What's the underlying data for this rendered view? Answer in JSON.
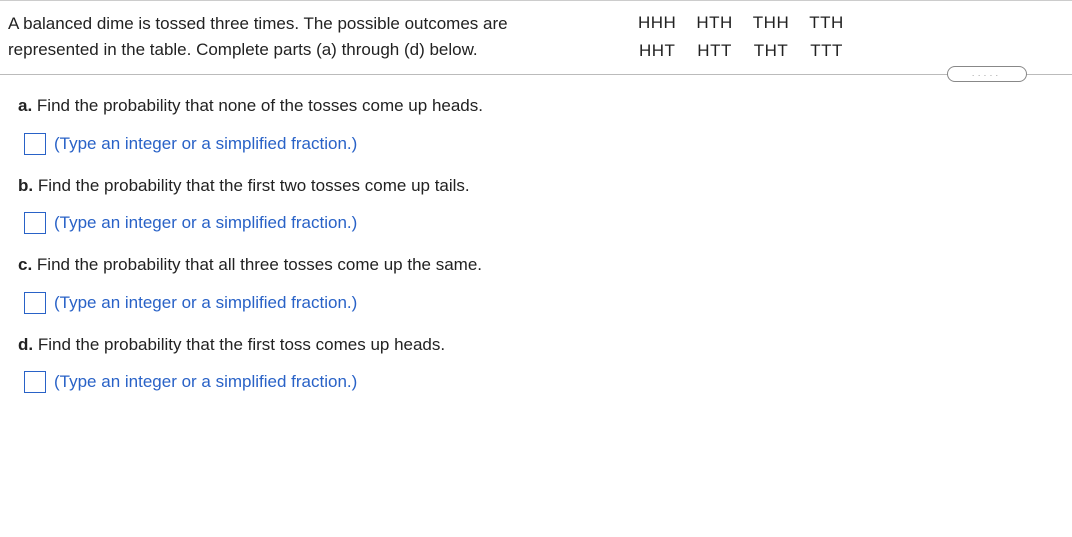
{
  "problem": {
    "description": "A balanced dime is tossed three times. The possible outcomes are represented in the table. Complete parts (a) through (d) below."
  },
  "outcomes": {
    "row1": [
      "HHH",
      "HTH",
      "THH",
      "TTH"
    ],
    "row2": [
      "HHT",
      "HTT",
      "THT",
      "TTT"
    ]
  },
  "pill_dots": ".....",
  "questions": {
    "a": {
      "label": "a.",
      "text": "Find the probability that none of the tosses come up heads.",
      "hint": "(Type an integer or a simplified fraction.)"
    },
    "b": {
      "label": "b.",
      "text": "Find the probability that the first two tosses come up tails.",
      "hint": "(Type an integer or a simplified fraction.)"
    },
    "c": {
      "label": "c.",
      "text": "Find the probability that all three tosses come up the same.",
      "hint": "(Type an integer or a simplified fraction.)"
    },
    "d": {
      "label": "d.",
      "text": "Find the probability that the first toss comes up heads.",
      "hint": "(Type an integer or a simplified fraction.)"
    }
  }
}
